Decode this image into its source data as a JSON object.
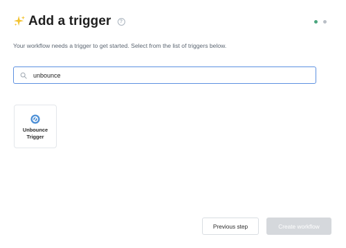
{
  "header": {
    "title": "Add a trigger",
    "help_glyph": "?",
    "icon": "sparkle-icon"
  },
  "steps": {
    "count": 2,
    "colors": [
      "#4aa57e",
      "#b9bfc6"
    ]
  },
  "subtitle": "Your workflow needs a trigger to get started. Select from the list of triggers below.",
  "search": {
    "value": "unbounce",
    "placeholder": "",
    "icon": "search-icon"
  },
  "results": [
    {
      "label": "Unbounce Trigger",
      "icon": "unbounce-logo-icon",
      "icon_color": "#4c8fd6"
    }
  ],
  "footer": {
    "previous_label": "Previous step",
    "create_label": "Create workflow"
  },
  "colors": {
    "accent": "#5b8fe0",
    "disabled": "#d5d8dc",
    "sparkle": "#f2c230"
  }
}
